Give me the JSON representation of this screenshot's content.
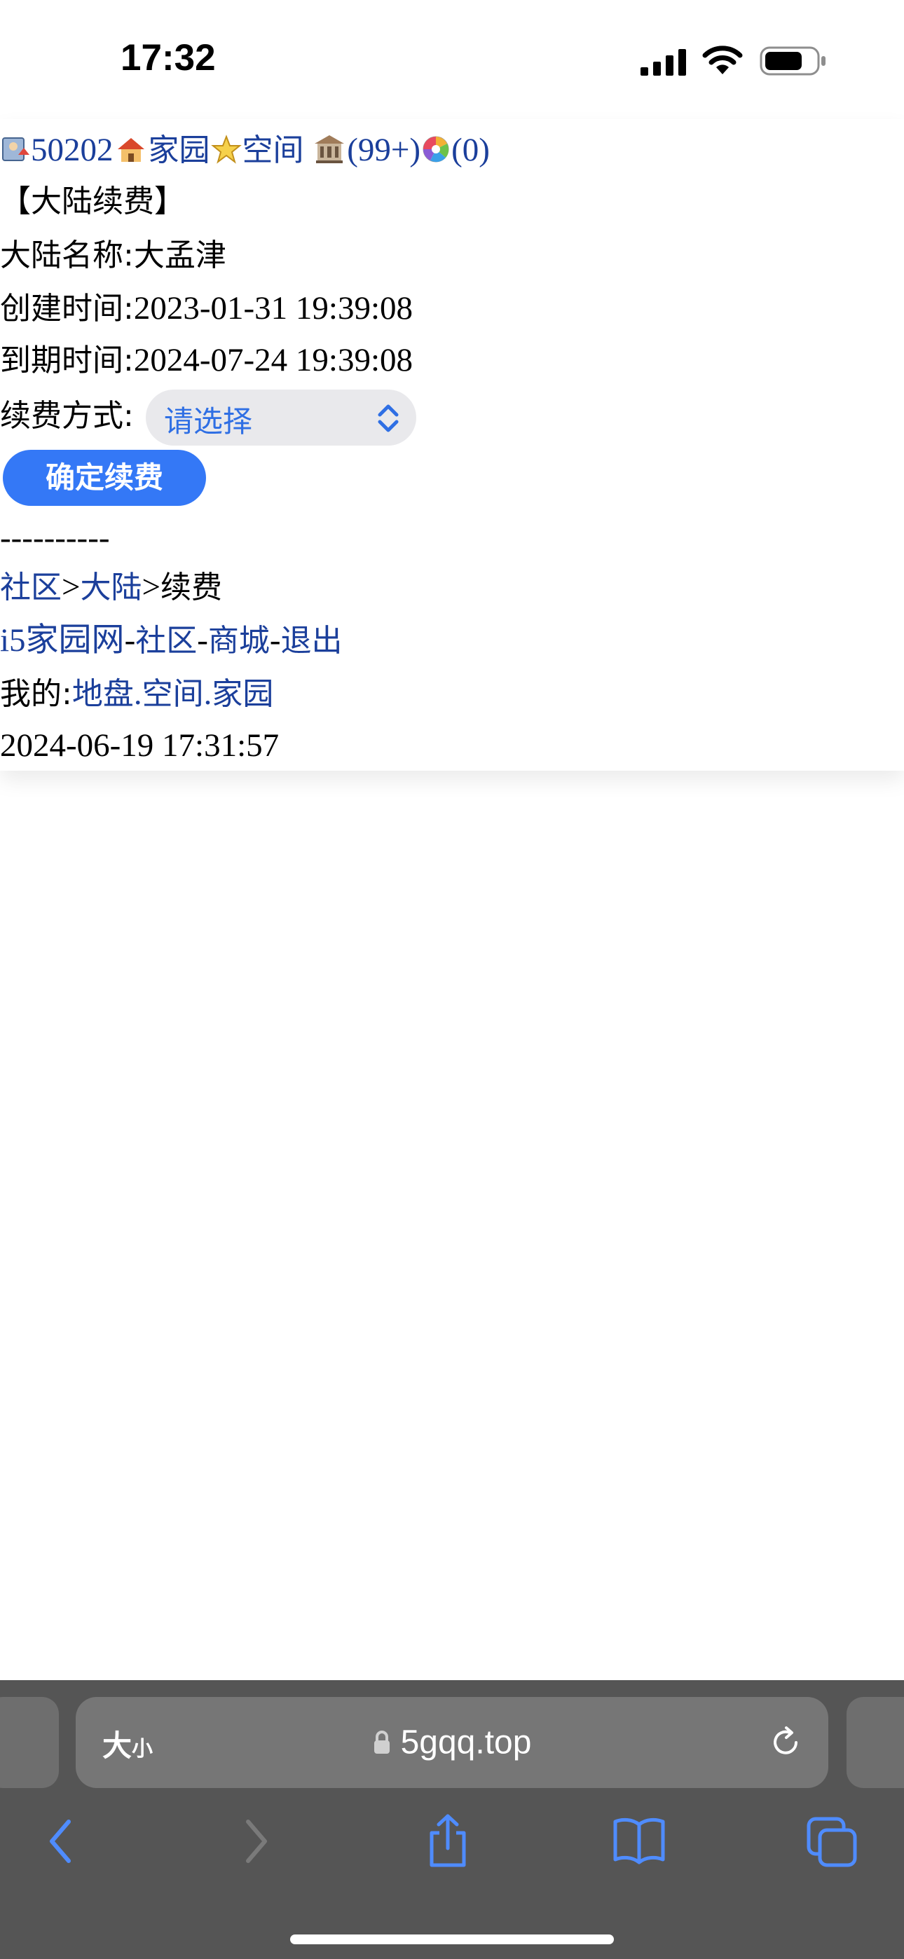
{
  "status_bar": {
    "time": "17:32"
  },
  "header": {
    "user_id": "50202",
    "home_link": "家园",
    "space_link": "空间",
    "messages_count": "(99+)",
    "other_count": "(0)"
  },
  "section_title": "【大陆续费】",
  "fields": {
    "name_label": "大陆名称:",
    "name_value": "大孟津",
    "created_label": "创建时间:",
    "created_value": "2023-01-31 19:39:08",
    "expire_label": "到期时间:",
    "expire_value": "2024-07-24 19:39:08",
    "method_label": "续费方式:"
  },
  "renew_select": {
    "selected": "请选择"
  },
  "confirm_button": "确定续费",
  "divider": "----------",
  "breadcrumb": {
    "community": "社区",
    "sep": ">",
    "continent": "大陆",
    "current": "续费"
  },
  "footer_nav": {
    "site": "i5家园网",
    "dash": "-",
    "community": "社区",
    "mall": "商城",
    "logout": "退出"
  },
  "mine": {
    "label": "我的:",
    "land": "地盘",
    "dot": ".",
    "space": "空间",
    "home": "家园"
  },
  "page_time": "2024-06-19 17:31:57",
  "browser": {
    "text_size_big": "大",
    "text_size_small": "小",
    "url": "5gqq.top"
  },
  "colors": {
    "link": "#1b3f9b",
    "button": "#3478f6",
    "chrome": "#555555",
    "toolbar_icon": "#4f8cff"
  }
}
